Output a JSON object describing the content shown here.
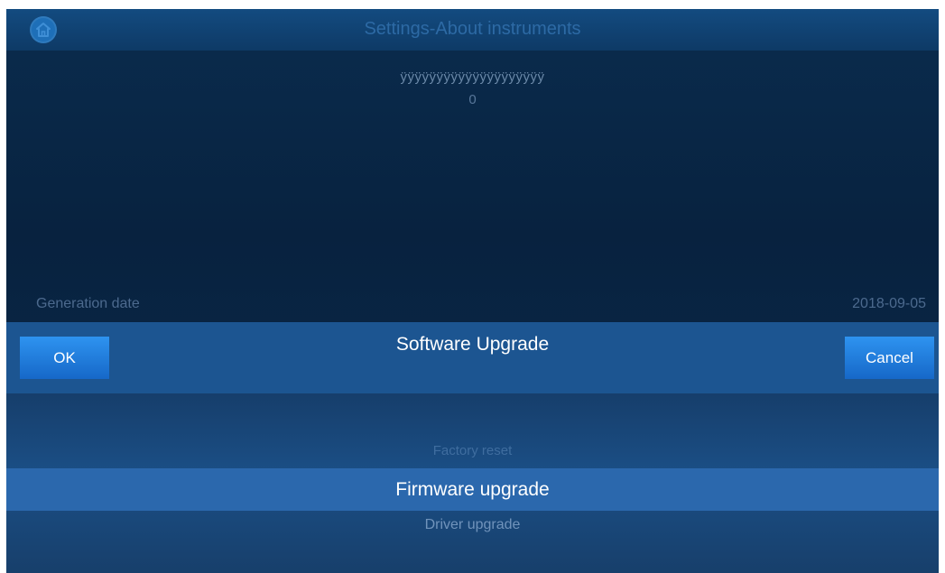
{
  "header": {
    "title": "Settings-About instruments",
    "home_icon": "home-icon"
  },
  "info": {
    "line1": "ÿÿÿÿÿÿÿÿÿÿÿÿÿÿÿÿÿÿÿÿ",
    "line2": "0"
  },
  "generation": {
    "label": "Generation date",
    "value": "2018-09-05"
  },
  "dialog": {
    "title": "Software Upgrade",
    "ok_label": "OK",
    "cancel_label": "Cancel",
    "options": [
      "Factory reset",
      "Firmware upgrade",
      "Driver upgrade"
    ],
    "selected": "Firmware upgrade"
  },
  "colors": {
    "accent": "#2a86e0",
    "selected_row": "#2b68ad",
    "background": "#08223f"
  }
}
